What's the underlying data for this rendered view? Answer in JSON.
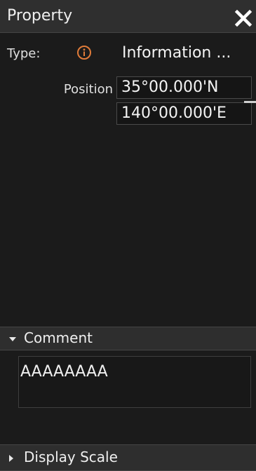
{
  "panel": {
    "title": "Property",
    "close_icon": "close-icon"
  },
  "type_row": {
    "label": "Type:",
    "icon": "info-icon",
    "icon_color": "#e07b39",
    "value": "Information ..."
  },
  "position_row": {
    "label": "Position",
    "latitude": "35°00.000'N",
    "longitude": "140°00.000'E"
  },
  "comment_section": {
    "label": "Comment",
    "expanded": true,
    "value": "AAAAAAAA"
  },
  "display_scale_section": {
    "label": "Display Scale",
    "expanded": false
  },
  "colors": {
    "background": "#1b1b1b",
    "header": "#2f2f2f",
    "text": "#f0f0f0",
    "accent": "#e07b39"
  }
}
